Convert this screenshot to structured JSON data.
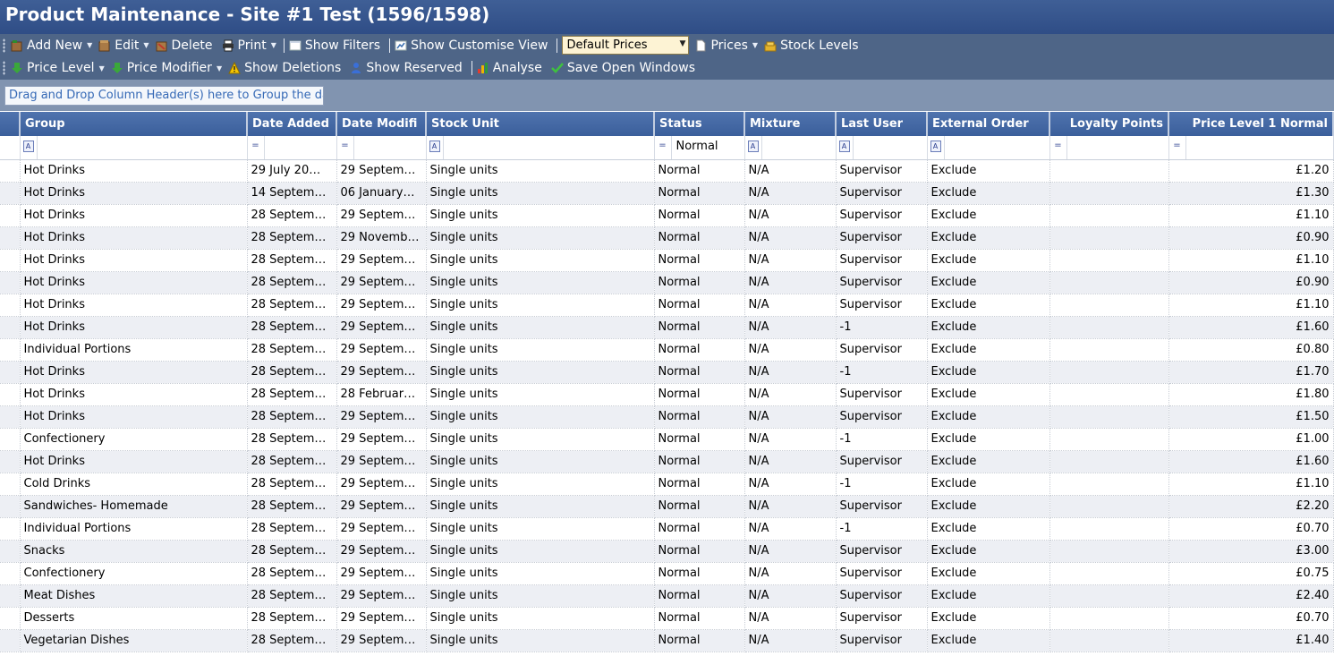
{
  "window": {
    "title": "Product Maintenance - Site #1 Test (1596/1598)"
  },
  "toolbar1": {
    "add_new": "Add New",
    "edit": "Edit",
    "delete": "Delete",
    "print": "Print",
    "show_filters": "Show Filters",
    "show_customise_view": "Show Customise View",
    "price_set_selected": "Default Prices",
    "prices": "Prices",
    "stock_levels": "Stock Levels"
  },
  "toolbar2": {
    "price_level": "Price Level",
    "price_modifier": "Price Modifier",
    "show_deletions": "Show Deletions",
    "show_reserved": "Show Reserved",
    "analyse": "Analyse",
    "save_open_windows": "Save Open Windows"
  },
  "group_panel": {
    "hint": "Drag and Drop Column Header(s) here to Group the data"
  },
  "grid": {
    "columns": [
      "Group",
      "Date Added",
      "Date Modifi",
      "Stock Unit",
      "Status",
      "Mixture",
      "Last User",
      "External Order",
      "Loyalty Points",
      "Price Level 1 Normal"
    ],
    "filters": {
      "status": "Normal"
    },
    "rows": [
      [
        "Hot Drinks",
        "29 July 20…",
        "29 Septem…",
        "Single units",
        "Normal",
        "N/A",
        "Supervisor",
        "Exclude",
        "",
        "£1.20"
      ],
      [
        "Hot Drinks",
        "14 Septem…",
        "06 January…",
        "Single units",
        "Normal",
        "N/A",
        "Supervisor",
        "Exclude",
        "",
        "£1.30"
      ],
      [
        "Hot Drinks",
        "28 Septem…",
        "29 Septem…",
        "Single units",
        "Normal",
        "N/A",
        "Supervisor",
        "Exclude",
        "",
        "£1.10"
      ],
      [
        "Hot Drinks",
        "28 Septem…",
        "29 Novemb…",
        "Single units",
        "Normal",
        "N/A",
        "Supervisor",
        "Exclude",
        "",
        "£0.90"
      ],
      [
        "Hot Drinks",
        "28 Septem…",
        "29 Septem…",
        "Single units",
        "Normal",
        "N/A",
        "Supervisor",
        "Exclude",
        "",
        "£1.10"
      ],
      [
        "Hot Drinks",
        "28 Septem…",
        "29 Septem…",
        "Single units",
        "Normal",
        "N/A",
        "Supervisor",
        "Exclude",
        "",
        "£0.90"
      ],
      [
        "Hot Drinks",
        "28 Septem…",
        "29 Septem…",
        "Single units",
        "Normal",
        "N/A",
        "Supervisor",
        "Exclude",
        "",
        "£1.10"
      ],
      [
        "Hot Drinks",
        "28 Septem…",
        "29 Septem…",
        "Single units",
        "Normal",
        "N/A",
        "-1",
        "Exclude",
        "",
        "£1.60"
      ],
      [
        "Individual Portions",
        "28 Septem…",
        "29 Septem…",
        "Single units",
        "Normal",
        "N/A",
        "Supervisor",
        "Exclude",
        "",
        "£0.80"
      ],
      [
        "Hot Drinks",
        "28 Septem…",
        "29 Septem…",
        "Single units",
        "Normal",
        "N/A",
        "-1",
        "Exclude",
        "",
        "£1.70"
      ],
      [
        "Hot Drinks",
        "28 Septem…",
        "28 Februar…",
        "Single units",
        "Normal",
        "N/A",
        "Supervisor",
        "Exclude",
        "",
        "£1.80"
      ],
      [
        "Hot Drinks",
        "28 Septem…",
        "29 Septem…",
        "Single units",
        "Normal",
        "N/A",
        "Supervisor",
        "Exclude",
        "",
        "£1.50"
      ],
      [
        "Confectionery",
        "28 Septem…",
        "29 Septem…",
        "Single units",
        "Normal",
        "N/A",
        "-1",
        "Exclude",
        "",
        "£1.00"
      ],
      [
        "Hot Drinks",
        "28 Septem…",
        "29 Septem…",
        "Single units",
        "Normal",
        "N/A",
        "Supervisor",
        "Exclude",
        "",
        "£1.60"
      ],
      [
        "Cold Drinks",
        "28 Septem…",
        "29 Septem…",
        "Single units",
        "Normal",
        "N/A",
        "-1",
        "Exclude",
        "",
        "£1.10"
      ],
      [
        "Sandwiches- Homemade",
        "28 Septem…",
        "29 Septem…",
        "Single units",
        "Normal",
        "N/A",
        "Supervisor",
        "Exclude",
        "",
        "£2.20"
      ],
      [
        "Individual Portions",
        "28 Septem…",
        "29 Septem…",
        "Single units",
        "Normal",
        "N/A",
        "-1",
        "Exclude",
        "",
        "£0.70"
      ],
      [
        "Snacks",
        "28 Septem…",
        "29 Septem…",
        "Single units",
        "Normal",
        "N/A",
        "Supervisor",
        "Exclude",
        "",
        "£3.00"
      ],
      [
        "Confectionery",
        "28 Septem…",
        "29 Septem…",
        "Single units",
        "Normal",
        "N/A",
        "Supervisor",
        "Exclude",
        "",
        "£0.75"
      ],
      [
        "Meat Dishes",
        "28 Septem…",
        "29 Septem…",
        "Single units",
        "Normal",
        "N/A",
        "Supervisor",
        "Exclude",
        "",
        "£2.40"
      ],
      [
        "Desserts",
        "28 Septem…",
        "29 Septem…",
        "Single units",
        "Normal",
        "N/A",
        "Supervisor",
        "Exclude",
        "",
        "£0.70"
      ],
      [
        "Vegetarian Dishes",
        "28 Septem…",
        "29 Septem…",
        "Single units",
        "Normal",
        "N/A",
        "Supervisor",
        "Exclude",
        "",
        "£1.40"
      ]
    ]
  }
}
